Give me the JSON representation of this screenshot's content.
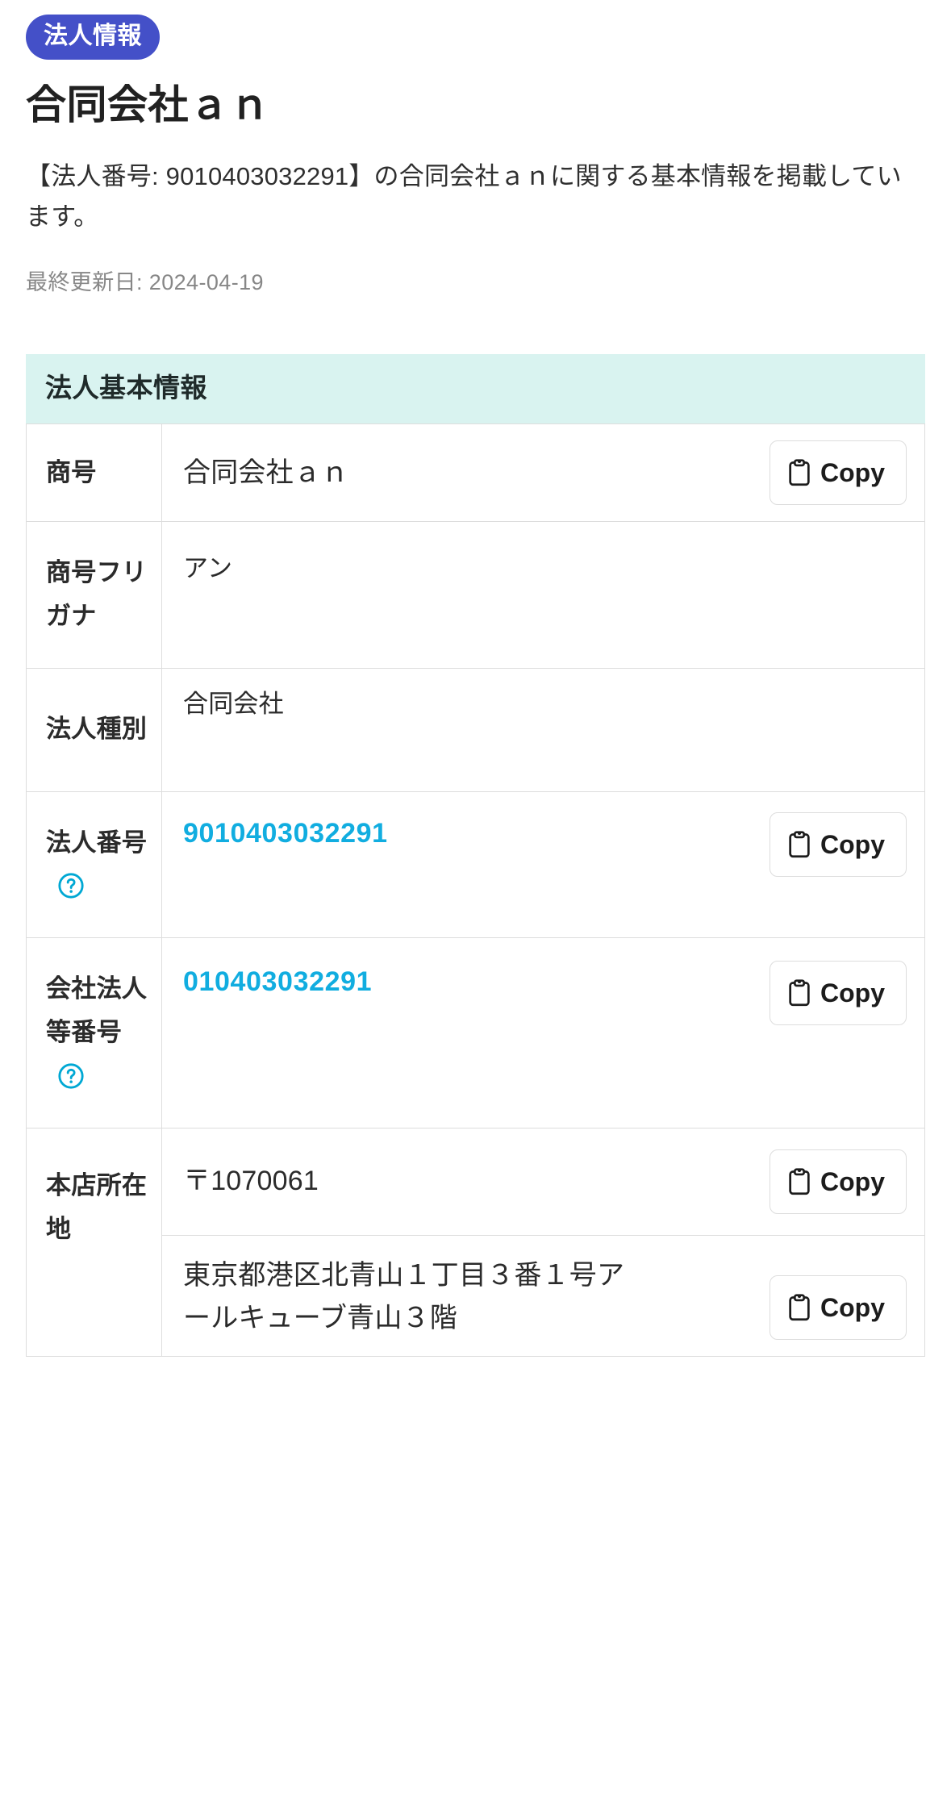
{
  "header": {
    "badge_label": "法人情報",
    "title": "合同会社ａｎ",
    "lead": "【法人番号: 9010403032291】の合同会社ａｎに関する基本情報を掲載しています。",
    "updated_label": "最終更新日: 2024-04-19"
  },
  "colors": {
    "badge_bg": "#4450c8",
    "section_bg": "#d9f3f0",
    "link": "#11ade0",
    "help_icon": "#00a8d4",
    "border": "#dddddd",
    "muted_text": "#878787"
  },
  "section": {
    "title": "法人基本情報"
  },
  "copy_button": {
    "label": "Copy",
    "icon": "clipboard-icon"
  },
  "help": {
    "icon": "question-circle-icon"
  },
  "table": {
    "rows": [
      {
        "label": "商号",
        "value": "合同会社ａｎ",
        "has_copy": true,
        "has_help": false,
        "is_link": false
      },
      {
        "label": "商号フリガナ",
        "value": "アン",
        "has_copy": false,
        "has_help": false,
        "is_link": false
      },
      {
        "label": "法人種別",
        "value": "合同会社",
        "has_copy": false,
        "has_help": false,
        "is_link": false
      },
      {
        "label": "法人番号",
        "value": "9010403032291",
        "has_copy": true,
        "has_help": true,
        "is_link": true
      },
      {
        "label": "会社法人等番号",
        "value": "010403032291",
        "has_copy": true,
        "has_help": true,
        "is_link": true
      },
      {
        "label": "本店所在地",
        "value": "〒1070061",
        "value2": "東京都港区北青山１丁目３番１号アールキューブ青山３階",
        "has_copy": true,
        "has_copy2": true,
        "has_help": false,
        "is_link": false
      }
    ]
  }
}
